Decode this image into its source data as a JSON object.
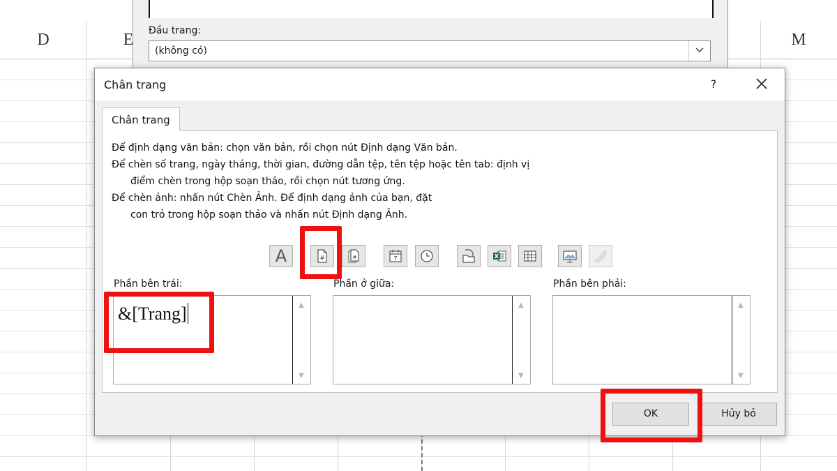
{
  "sheet": {
    "columns": [
      {
        "id": "D",
        "label": "D"
      },
      {
        "id": "E",
        "label": "E"
      },
      {
        "id": "M",
        "label": "M"
      }
    ]
  },
  "back_dialog": {
    "header_label": "Đầu trang:",
    "header_value": "(không có)"
  },
  "dialog": {
    "title": "Chân trang",
    "help": "?",
    "tab": "Chân trang",
    "instructions": [
      "Để định dạng văn bản: chọn văn bản, rồi chọn nút Định dạng Văn bản.",
      "Để chèn số trang, ngày tháng, thời gian, đường dẫn tệp, tên tệp hoặc tên tab:  định vị",
      "điểm chèn trong hộp soạn thảo, rồi chọn nút tương ứng.",
      "Để chèn ảnh: nhấn nút Chèn Ảnh.  Để định dạng ảnh của bạn, đặt",
      "con trỏ trong hộp soạn thảo và nhấn nút Định dạng Ảnh."
    ],
    "toolbar_icons": [
      "format-text-icon",
      "page-number-icon",
      "page-count-icon",
      "date-icon",
      "time-icon",
      "file-path-icon",
      "file-name-icon",
      "sheet-name-icon",
      "insert-picture-icon",
      "format-picture-icon"
    ],
    "sections": {
      "left_label": "Phần bên trái:",
      "center_label": "Phần ở giữa:",
      "right_label": "Phần bên phải:",
      "left_value": "&[Trang]",
      "center_value": "",
      "right_value": ""
    },
    "ok_label": "OK",
    "cancel_label": "Hủy bỏ"
  },
  "colors": {
    "highlight": "#ee1111",
    "dialog_bg": "#f0f0f0",
    "excel_green": "#1d7044"
  }
}
